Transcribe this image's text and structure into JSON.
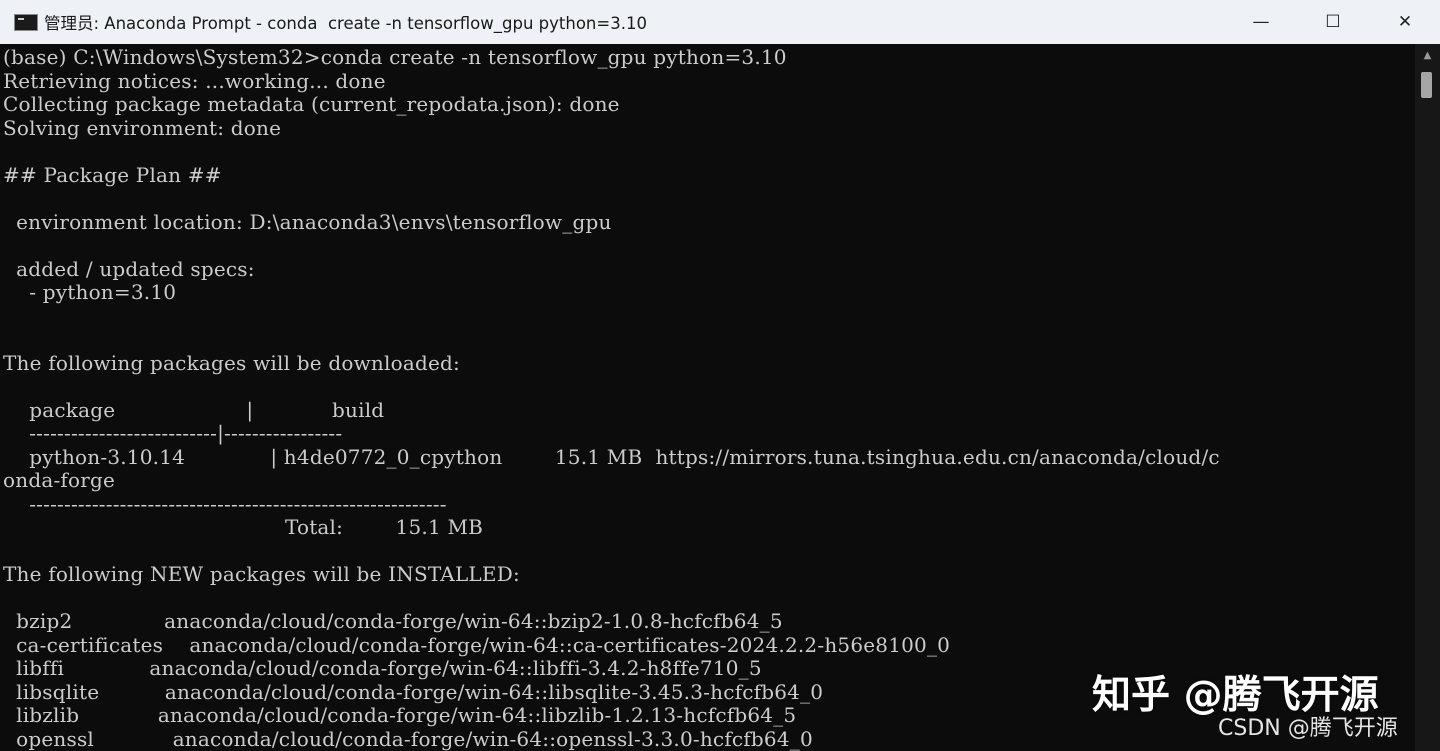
{
  "window": {
    "title": "管理员: Anaconda Prompt - conda  create -n tensorflow_gpu python=3.10",
    "controls": {
      "minimize": "—",
      "maximize": "☐",
      "close": "✕"
    }
  },
  "terminal": {
    "lines": [
      "(base) C:\\Windows\\System32>conda create -n tensorflow_gpu python=3.10",
      "Retrieving notices: ...working... done",
      "Collecting package metadata (current_repodata.json): done",
      "Solving environment: done",
      "",
      "## Package Plan ##",
      "",
      "  environment location: D:\\anaconda3\\envs\\tensorflow_gpu",
      "",
      "  added / updated specs:",
      "    - python=3.10",
      "",
      "",
      "The following packages will be downloaded:",
      "",
      "    package                    |            build",
      "    ---------------------------|-----------------",
      "    python-3.10.14             | h4de0772_0_cpython        15.1 MB  https://mirrors.tuna.tsinghua.edu.cn/anaconda/cloud/c",
      "onda-forge",
      "    ------------------------------------------------------------",
      "                                           Total:        15.1 MB",
      "",
      "The following NEW packages will be INSTALLED:",
      "",
      "  bzip2              anaconda/cloud/conda-forge/win-64::bzip2-1.0.8-hcfcfb64_5",
      "  ca-certificates    anaconda/cloud/conda-forge/win-64::ca-certificates-2024.2.2-h56e8100_0",
      "  libffi             anaconda/cloud/conda-forge/win-64::libffi-3.4.2-h8ffe710_5",
      "  libsqlite          anaconda/cloud/conda-forge/win-64::libsqlite-3.45.3-hcfcfb64_0",
      "  libzlib            anaconda/cloud/conda-forge/win-64::libzlib-1.2.13-hcfcfb64_5",
      "  openssl            anaconda/cloud/conda-forge/win-64::openssl-3.3.0-hcfcfb64_0"
    ]
  },
  "watermarks": {
    "zhihu": "知乎 @腾飞开源",
    "csdn": "CSDN @腾飞开源"
  },
  "colors": {
    "terminal_bg": "#0c0c0c",
    "terminal_fg": "#cccccc",
    "titlebar_bg": "#eef1f5"
  }
}
